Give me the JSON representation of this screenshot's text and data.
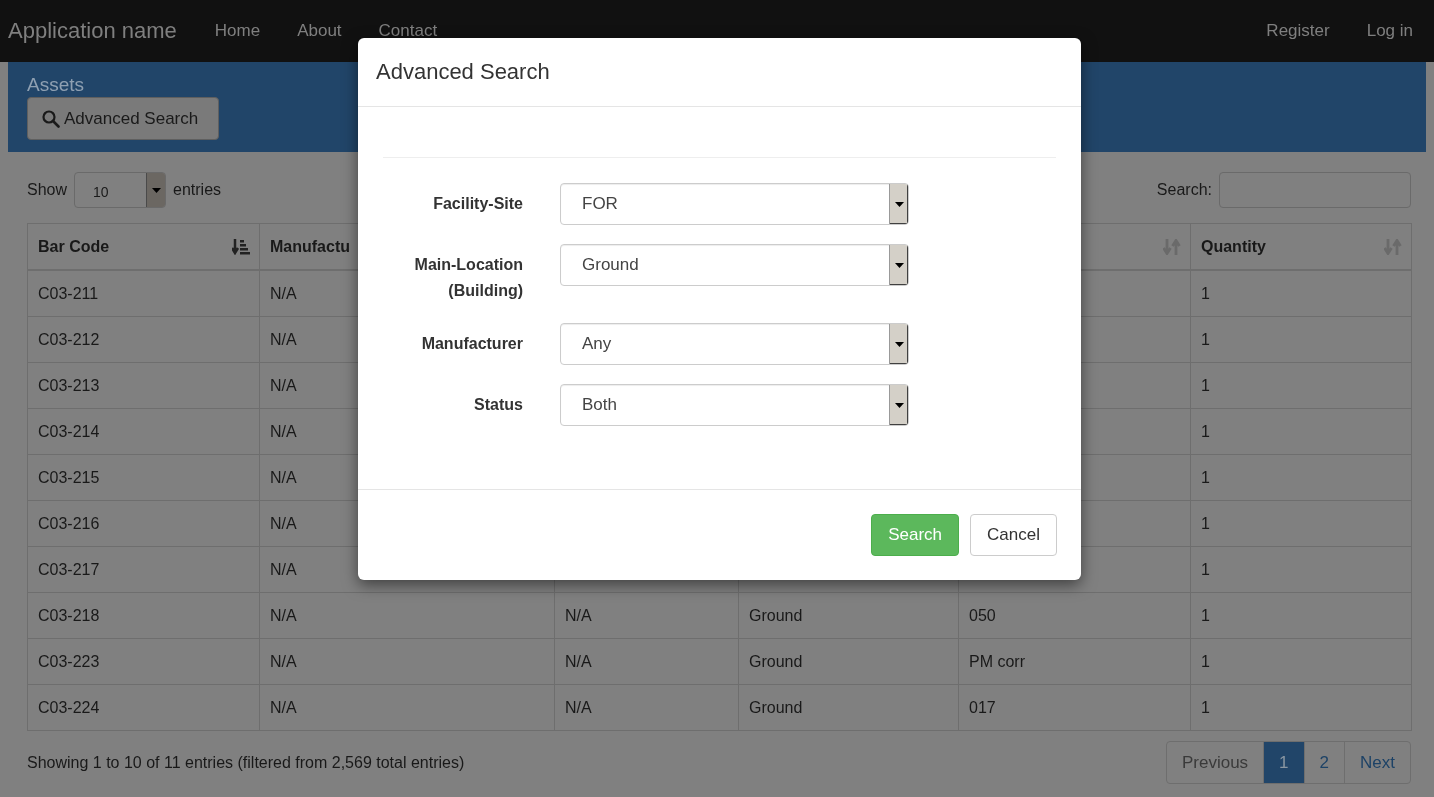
{
  "navbar": {
    "brand": "Application name",
    "links": [
      "Home",
      "About",
      "Contact"
    ],
    "right_links": [
      "Register",
      "Log in"
    ]
  },
  "panel": {
    "title": "Assets",
    "button": "Advanced Search"
  },
  "length_menu": {
    "label_before": "Show",
    "value": "10",
    "label_after": "entries"
  },
  "search": {
    "label": "Search:"
  },
  "table": {
    "columns": [
      {
        "label": "Bar Code",
        "sortable": true,
        "sorted": true
      },
      {
        "label": "Manufactu"
      },
      {},
      {},
      {
        "sortable": true,
        "sorted": false
      },
      {
        "label": "Quantity",
        "sortable": true,
        "sorted": false
      }
    ],
    "rows": [
      [
        "C03-211",
        "N/A",
        null,
        null,
        null,
        "1"
      ],
      [
        "C03-212",
        "N/A",
        null,
        null,
        null,
        "1"
      ],
      [
        "C03-213",
        "N/A",
        null,
        null,
        null,
        "1"
      ],
      [
        "C03-214",
        "N/A",
        null,
        null,
        null,
        "1"
      ],
      [
        "C03-215",
        "N/A",
        null,
        null,
        null,
        "1"
      ],
      [
        "C03-216",
        "N/A",
        null,
        null,
        null,
        "1"
      ],
      [
        "C03-217",
        "N/A",
        null,
        null,
        null,
        "1"
      ],
      [
        "C03-218",
        "N/A",
        "N/A",
        "Ground",
        "050",
        "1"
      ],
      [
        "C03-223",
        "N/A",
        "N/A",
        "Ground",
        "PM corr",
        "1"
      ],
      [
        "C03-224",
        "N/A",
        "N/A",
        "Ground",
        "017",
        "1"
      ]
    ]
  },
  "info": "Showing 1 to 10 of 11 entries (filtered from 2,569 total entries)",
  "pagination": [
    {
      "label": "Previous",
      "selected": false,
      "disabled": true
    },
    {
      "label": "1",
      "selected": true,
      "disabled": false
    },
    {
      "label": "2",
      "selected": false,
      "disabled": false
    },
    {
      "label": "Next",
      "selected": false,
      "disabled": false
    }
  ],
  "modal": {
    "title": "Advanced Search",
    "fields": [
      {
        "label": "Facility-Site",
        "value": "FOR"
      },
      {
        "label": "Main-Location (Building)",
        "value": "Ground"
      },
      {
        "label": "Manufacturer",
        "value": "Any"
      },
      {
        "label": "Status",
        "value": "Both"
      }
    ],
    "buttons": [
      {
        "label": "Search",
        "kind": "primary"
      },
      {
        "label": "Cancel",
        "kind": "default"
      }
    ]
  }
}
